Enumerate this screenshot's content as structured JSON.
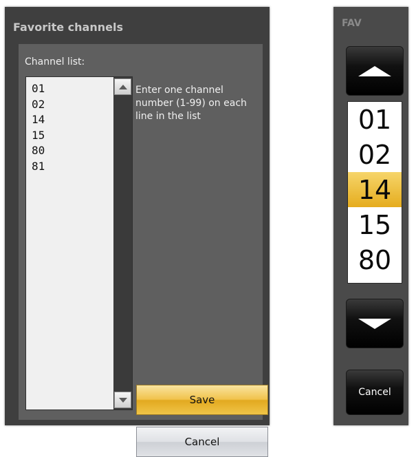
{
  "dialog": {
    "title": "Favorite channels",
    "list_label": "Channel list:",
    "channels": [
      "01",
      "02",
      "14",
      "15",
      "80",
      "81"
    ],
    "help_text": "Enter one channel number (1-99) on each line in the list",
    "save_label": "Save",
    "cancel_label": "Cancel"
  },
  "fav": {
    "title": "FAV",
    "visible_channels": [
      "01",
      "02",
      "14",
      "15",
      "80"
    ],
    "selected": "14",
    "cancel_label": "Cancel"
  },
  "icons": {
    "scroll_up": "triangle-up-icon",
    "scroll_down": "triangle-down-icon",
    "fav_up": "arrow-up-icon",
    "fav_down": "arrow-down-icon"
  },
  "colors": {
    "dialog_bg": "#3f3f3f",
    "panel_bg": "#5f5f5f",
    "accent_gold": "#e5ac1e",
    "list_bg": "#f0f0f0"
  }
}
